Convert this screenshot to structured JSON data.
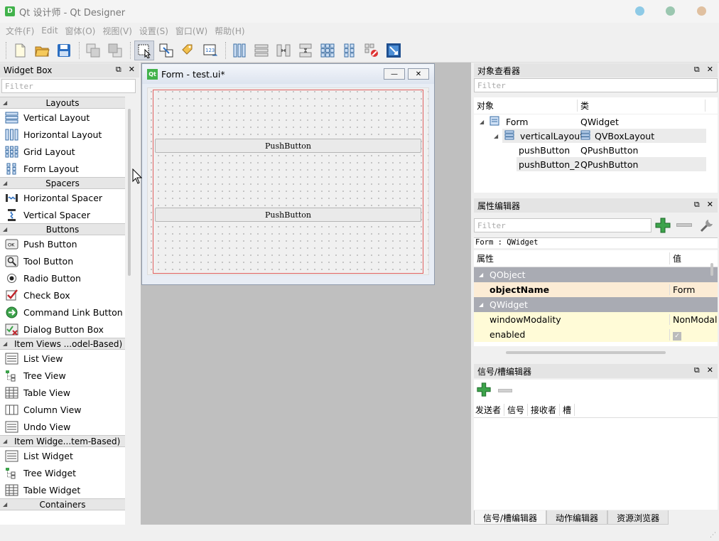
{
  "window": {
    "title": "Qt 设计师 - Qt Designer"
  },
  "menu": [
    "文件(F)",
    "Edit",
    "窗体(O)",
    "视图(V)",
    "设置(S)",
    "窗口(W)",
    "帮助(H)"
  ],
  "widget_box": {
    "title": "Widget Box",
    "filter_placeholder": "Filter",
    "categories": [
      {
        "label": "Layouts",
        "items": [
          "Vertical Layout",
          "Horizontal Layout",
          "Grid Layout",
          "Form Layout"
        ]
      },
      {
        "label": "Spacers",
        "items": [
          "Horizontal Spacer",
          "Vertical Spacer"
        ]
      },
      {
        "label": "Buttons",
        "items": [
          "Push Button",
          "Tool Button",
          "Radio Button",
          "Check Box",
          "Command Link Button",
          "Dialog Button Box"
        ]
      },
      {
        "label": "Item Views ...odel-Based)",
        "items": [
          "List View",
          "Tree View",
          "Table View",
          "Column View",
          "Undo View"
        ]
      },
      {
        "label": "Item Widge...tem-Based)",
        "items": [
          "List Widget",
          "Tree Widget",
          "Table Widget"
        ]
      },
      {
        "label": "Containers",
        "items": []
      }
    ]
  },
  "form_window": {
    "title": "Form - test.ui*",
    "buttons": [
      "PushButton",
      "PushButton"
    ]
  },
  "object_inspector": {
    "title": "对象查看器",
    "filter_placeholder": "Filter",
    "col_object": "对象",
    "col_class": "类",
    "rows": [
      {
        "name": "Form",
        "class": "QWidget"
      },
      {
        "name": "verticalLayout",
        "class": "QVBoxLayout"
      },
      {
        "name": "pushButton",
        "class": "QPushButton"
      },
      {
        "name": "pushButton_2",
        "class": "QPushButton"
      }
    ]
  },
  "property_editor": {
    "title": "属性编辑器",
    "filter_placeholder": "Filter",
    "path": "Form : QWidget",
    "col_property": "属性",
    "col_value": "值",
    "groups": [
      {
        "name": "QObject",
        "props": [
          {
            "name": "objectName",
            "value": "Form"
          }
        ]
      },
      {
        "name": "QWidget",
        "props": [
          {
            "name": "windowModality",
            "value": "NonModal"
          },
          {
            "name": "enabled",
            "value": ""
          }
        ]
      }
    ]
  },
  "signal_slot_editor": {
    "title": "信号/槽编辑器",
    "columns": [
      "发送者",
      "信号",
      "接收者",
      "槽"
    ]
  },
  "bottom_tabs": [
    "信号/槽编辑器",
    "动作编辑器",
    "资源浏览器"
  ],
  "colors": {
    "accent_green": "#41b24b",
    "group_header": "#a9abb3",
    "property_yellow": "#fffbd7",
    "layout_red": "#e06060"
  }
}
